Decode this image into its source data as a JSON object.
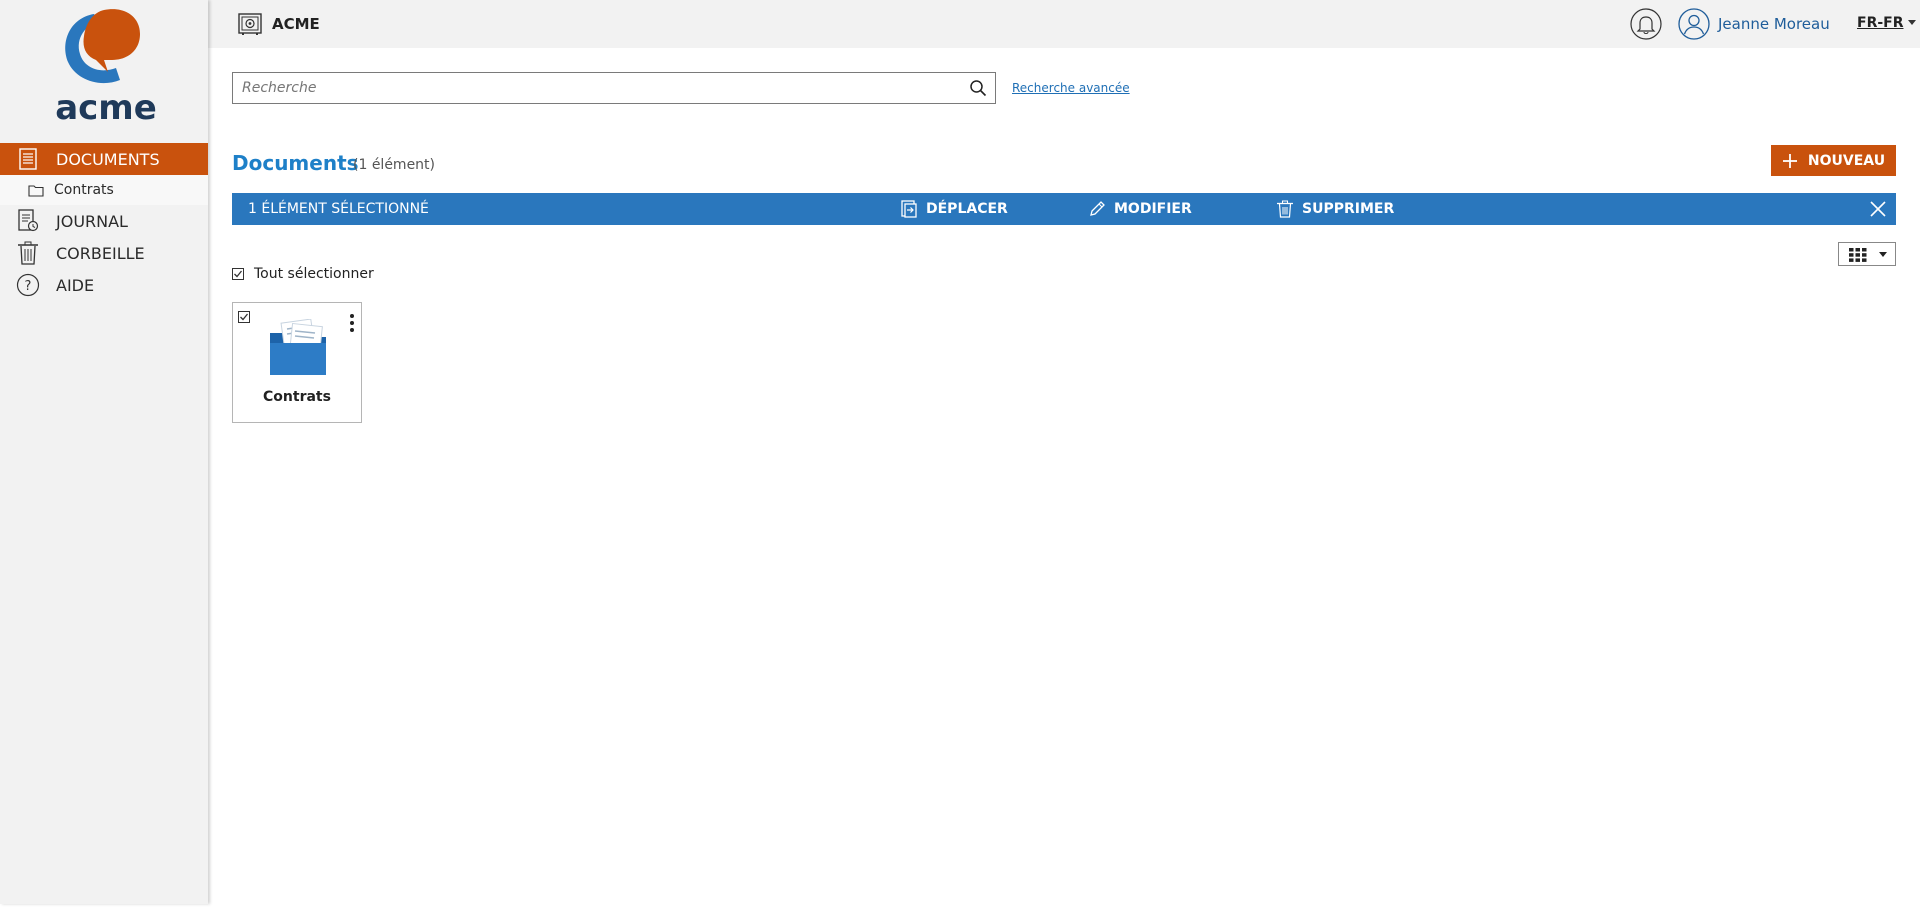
{
  "brand": {
    "logo_text": "acme",
    "colors": {
      "orange": "#c9520d",
      "navy": "#1f3a5a",
      "blue": "#2a77bd",
      "link": "#1f6fb5"
    }
  },
  "sidebar": {
    "items": [
      {
        "label": "DOCUMENTS",
        "icon": "document-list-icon",
        "active": true
      },
      {
        "label": "Contrats",
        "icon": "folder-outline-icon",
        "sub": true
      },
      {
        "label": "JOURNAL",
        "icon": "journal-icon"
      },
      {
        "label": "CORBEILLE",
        "icon": "trash-icon"
      },
      {
        "label": "AIDE",
        "icon": "help-circle-icon"
      }
    ]
  },
  "header": {
    "workspace_icon": "safe-icon",
    "workspace_name": "ACME",
    "bell_icon": "bell-icon",
    "user_icon": "user-circle-icon",
    "user_name": "Jeanne Moreau",
    "language": "FR-FR"
  },
  "search": {
    "placeholder": "Recherche",
    "value": "",
    "advanced_label": "Recherche avancée"
  },
  "main": {
    "title": "Documents",
    "count_text": "(1 élément)",
    "new_button_label": "NOUVEAU",
    "selection_bar": {
      "selected_text": "1 ÉLÉMENT SÉLECTIONNÉ",
      "move_label": "DÉPLACER",
      "edit_label": "MODIFIER",
      "delete_label": "SUPPRIMER"
    },
    "select_all_label": "Tout sélectionner",
    "items": [
      {
        "name": "Contrats",
        "type": "folder",
        "selected": true
      }
    ]
  }
}
